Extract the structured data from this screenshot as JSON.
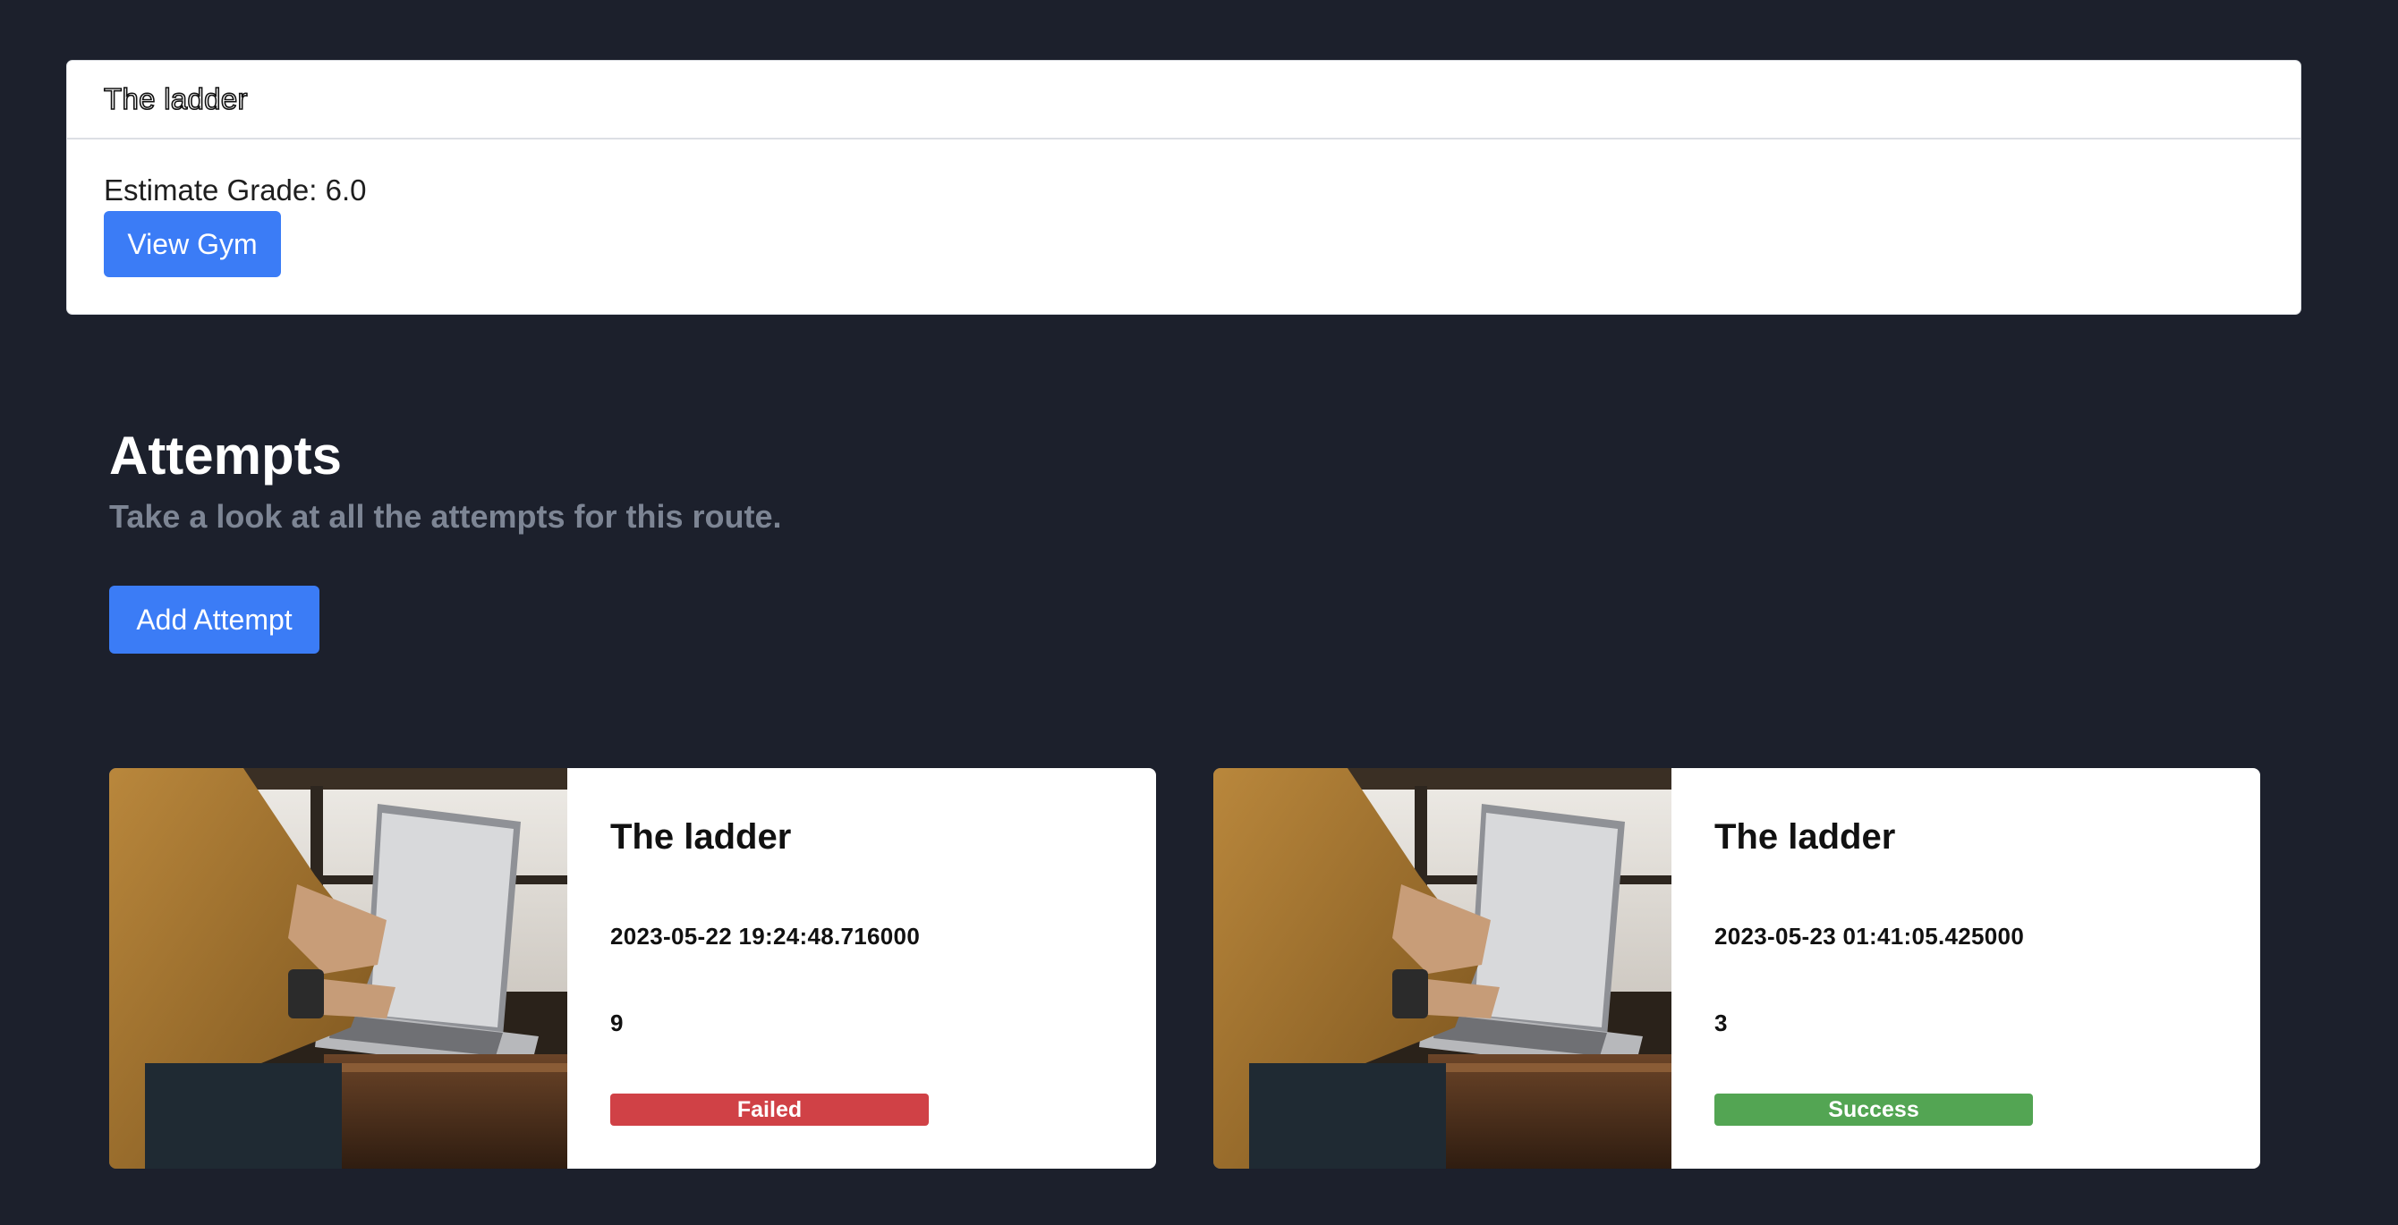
{
  "route": {
    "title": "The ladder",
    "estimate_grade": "Estimate Grade: 6.0",
    "view_gym_label": "View Gym"
  },
  "attempts_section": {
    "heading": "Attempts",
    "subtitle": "Take a look at all the attempts for this route.",
    "add_attempt_label": "Add Attempt",
    "items": [
      {
        "route_name": "The ladder",
        "timestamp": "2023-05-22 19:24:48.716000",
        "count": "9",
        "status": "Failed",
        "status_color": "#d04146",
        "image": "person-typing-on-laptop-photo"
      },
      {
        "route_name": "The ladder",
        "timestamp": "2023-05-23 01:41:05.425000",
        "count": "3",
        "status": "Success",
        "status_color": "#53a553",
        "image": "person-typing-on-laptop-photo"
      }
    ]
  },
  "colors": {
    "page_background": "#1c202c",
    "primary_button": "#3b7cf6",
    "subtitle_text": "#7d8594"
  }
}
